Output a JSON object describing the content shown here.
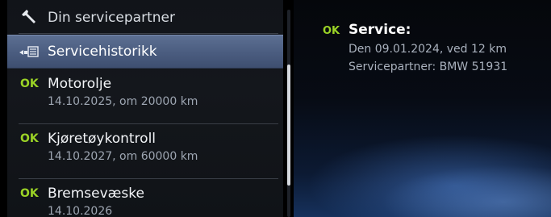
{
  "menu": {
    "partner": {
      "label": "Din servicepartner",
      "icon": "wrench-icon"
    },
    "history": {
      "label": "Servicehistorikk",
      "icon": "service-history-icon"
    },
    "items": [
      {
        "status": "OK",
        "title": "Motorolje",
        "detail": "14.10.2025, om 20000 km"
      },
      {
        "status": "OK",
        "title": "Kjøretøykontroll",
        "detail": "14.10.2027, om 60000 km"
      },
      {
        "status": "OK",
        "title": "Bremsevæske",
        "detail": "14.10.2026"
      }
    ]
  },
  "detail": {
    "status": "OK",
    "title": "Service:",
    "line1": "Den 09.01.2024, ved 12 km",
    "line2": "Servicepartner: BMW 51931"
  },
  "colors": {
    "ok": "#9bd326",
    "highlight": "#4a5c7f",
    "text": "#f2f4f7",
    "subtext": "#9ea6b2"
  }
}
